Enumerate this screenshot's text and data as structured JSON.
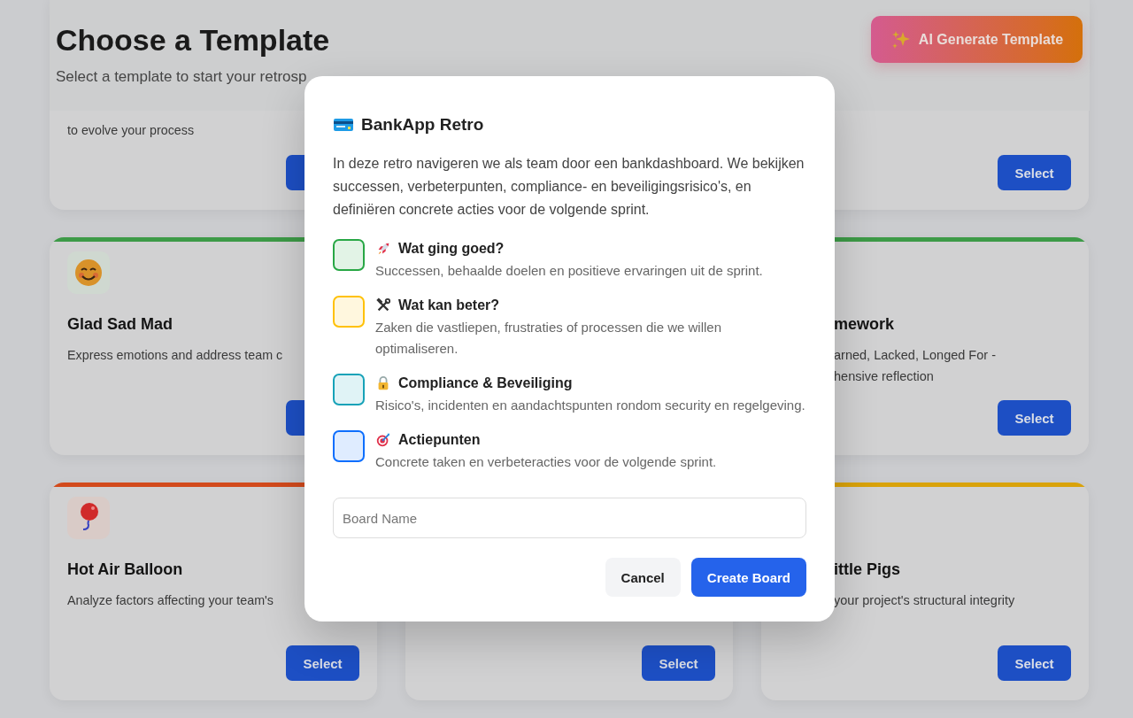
{
  "header": {
    "title": "Choose a Template",
    "subtitle": "Select a template to start your retrosp",
    "ai_button": "AI Generate Template"
  },
  "cards": [
    {
      "kind": "left",
      "description": [
        "to evolve your process"
      ],
      "select_hidden": true
    },
    {
      "kind": "right",
      "select": "Select"
    },
    {
      "kind": "left",
      "color": "#3d9a47",
      "title": "Glad Sad Mad",
      "description": [
        "Express emotions and address team c"
      ],
      "select_hidden": true
    },
    {
      "kind": "right",
      "color": "#3d9a47",
      "title": "mework",
      "description": [
        "arned, Lacked, Longed For -",
        "hensive reflection"
      ],
      "select": "Select"
    },
    {
      "kind": "left",
      "color": "#d24a1c",
      "title": "Hot Air Balloon",
      "description": [
        "Analyze factors affecting your team's"
      ],
      "select": "Select"
    },
    {
      "kind": "middle",
      "select": "Select"
    },
    {
      "kind": "right",
      "color": "#d9a20a",
      "title": "ittle Pigs",
      "description": [
        "your project's structural integrity"
      ],
      "select": "Select"
    }
  ],
  "modal": {
    "title": "BankApp Retro",
    "description": "In deze retro navigeren we als team door een bankdashboard. We bekijken successen, verbeterpunten, compliance- en beveiligingsrisico's, en definiëren concrete acties voor de volgende sprint.",
    "columns": [
      {
        "color": "#28a745",
        "title": "Wat ging goed?",
        "description": "Successen, behaalde doelen en positieve ervaringen uit de sprint."
      },
      {
        "color": "#ffc107",
        "title": "Wat kan beter?",
        "description": "Zaken die vastliepen, frustraties of processen die we willen optimaliseren."
      },
      {
        "color": "#17a2b8",
        "title": "Compliance & Beveiliging",
        "description": "Risico's, incidenten en aandachtspunten rondom security en regelgeving."
      },
      {
        "color": "#0d6efd",
        "title": "Actiepunten",
        "description": "Concrete taken en verbeteracties voor de volgende sprint."
      }
    ],
    "input": {
      "placeholder": "Board Name"
    },
    "cancel": "Cancel",
    "create": "Create Board"
  }
}
